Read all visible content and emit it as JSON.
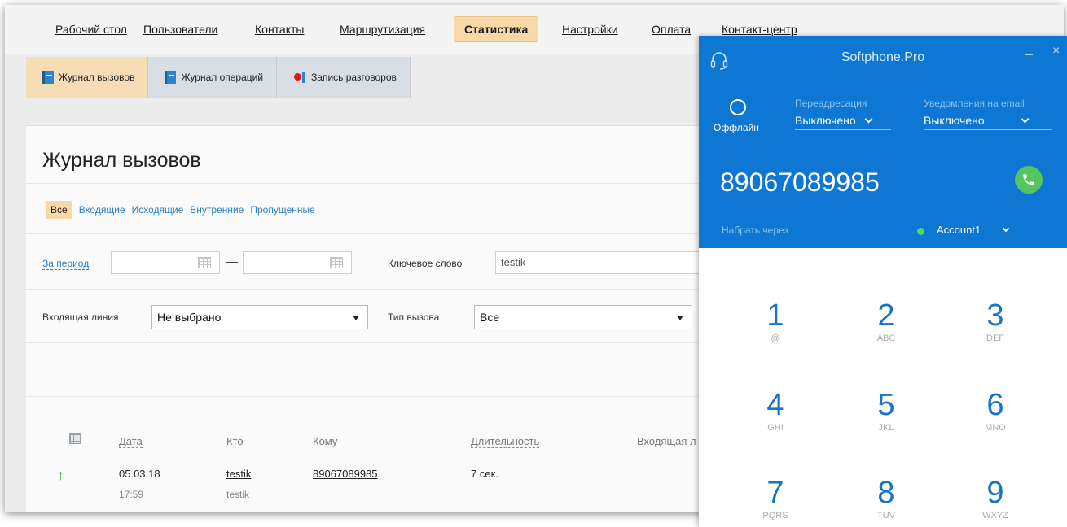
{
  "nav": {
    "items": [
      "Рабочий стол",
      "Пользователи",
      "Контакты",
      "Маршрутизация",
      "Статистика",
      "Настройки",
      "Оплата",
      "Контакт-центр"
    ],
    "active": "Статистика"
  },
  "subtabs": [
    "Журнал вызовов",
    "Журнал операций",
    "Запись разговоров"
  ],
  "page": {
    "title": "Журнал вызовов",
    "filters": [
      "Все",
      "Входящие",
      "Исходящие",
      "Внутренние",
      "Пропущенные"
    ],
    "period_label": "За период",
    "period_dash": "—",
    "keyword_label": "Ключевое слово",
    "keyword_value": "testik",
    "incoming_line_label": "Входящая линия",
    "incoming_line_value": "Не выбрано",
    "call_type_label": "Тип вызова",
    "call_type_value": "Все"
  },
  "table": {
    "headers": [
      "Дата",
      "Кто",
      "Кому",
      "Длительность",
      "Входящая л"
    ],
    "rows": [
      {
        "date": "05.03.18",
        "time": "17:59",
        "who": "testik",
        "who_sub": "testik",
        "to": "89067089985",
        "duration": "7 сек."
      }
    ]
  },
  "softphone": {
    "title": "Softphone.Pro",
    "minimize": "–",
    "close": "×",
    "status": "Оффлайн",
    "forwarding_label": "Переадресация",
    "forwarding_value": "Выключено",
    "email_label": "Уведомления на email",
    "email_value": "Выключено",
    "number": "89067089985",
    "dial_via": "Набрать через",
    "account": "Account1",
    "keys": [
      {
        "d": "1",
        "s": "@"
      },
      {
        "d": "2",
        "s": "ABC"
      },
      {
        "d": "3",
        "s": "DEF"
      },
      {
        "d": "4",
        "s": "GHI"
      },
      {
        "d": "5",
        "s": "JKL"
      },
      {
        "d": "6",
        "s": "MNO"
      },
      {
        "d": "7",
        "s": "PQRS"
      },
      {
        "d": "8",
        "s": "TUV"
      },
      {
        "d": "9",
        "s": "WXYZ"
      }
    ],
    "colors": {
      "header": "#0e77d4",
      "call": "#55c55f",
      "online": "#56d85a"
    }
  }
}
